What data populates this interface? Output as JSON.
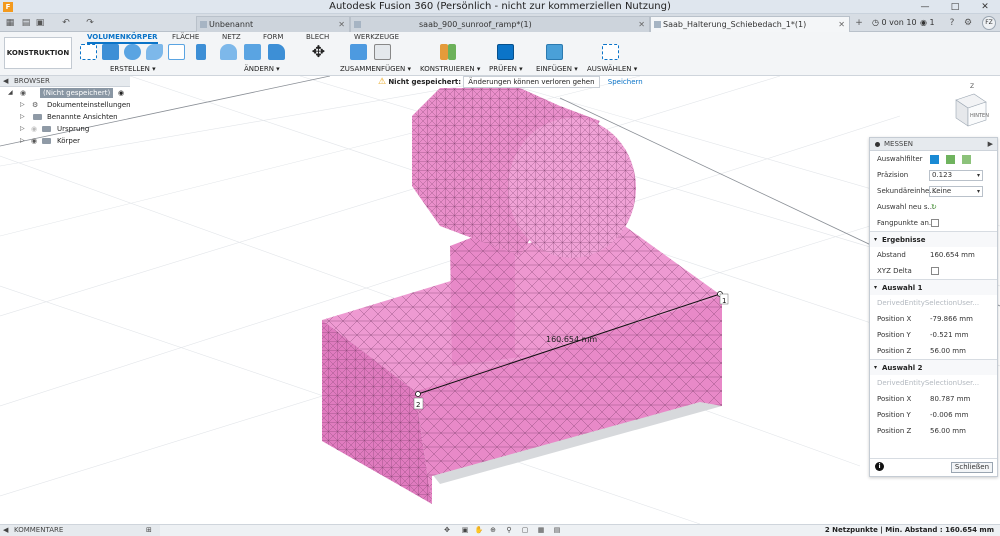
{
  "window": {
    "title": "Autodesk Fusion 360 (Persönlich - nicht zur kommerziellen Nutzung)",
    "app_icon": "F"
  },
  "tabs": [
    {
      "label": "Unbenannt",
      "active": false
    },
    {
      "label": "saab_900_sunroof_ramp*(1)",
      "active": false
    },
    {
      "label": "Saab_Halterung_Schiebedach_1*(1)",
      "active": true
    }
  ],
  "tabbar_right": {
    "jobs": "0 von 10",
    "notifications": "1",
    "avatar": "FZ"
  },
  "toolbar": {
    "workspace": "KONSTRUKTION",
    "ribbon_tabs": [
      "VOLUMENKÖRPER",
      "FLÄCHE",
      "NETZ",
      "FORM",
      "BLECH",
      "WERKZEUGE"
    ],
    "groups": [
      "ERSTELLEN",
      "ÄNDERN",
      "ZUSAMMENFÜGEN",
      "KONSTRUIEREN",
      "PRÜFEN",
      "EINFÜGEN",
      "AUSWÄHLEN"
    ]
  },
  "browser": {
    "header": "BROWSER",
    "root": "(Nicht gespeichert)",
    "items": [
      "Dokumenteinstellungen",
      "Benannte Ansichten",
      "Ursprung",
      "Körper"
    ]
  },
  "save_banner": {
    "label": "Nicht gespeichert:",
    "message": "Änderungen können verloren gehen",
    "link": "Speichern"
  },
  "viewport": {
    "dimension_label": "160.654 mm",
    "point1": "1",
    "point2": "2",
    "viewcube_face": "HINTEN",
    "viewcube_axis": "Z"
  },
  "measure": {
    "title": "MESSEN",
    "rows": {
      "filter_label": "Auswahlfilter",
      "precision_label": "Präzision",
      "precision_value": "0.123",
      "secondary_label": "Sekundäreinhe...",
      "secondary_value": "Keine",
      "reselect_label": "Auswahl neu s...",
      "snap_label": "Fangpunkte an..."
    },
    "results": {
      "header": "Ergebnisse",
      "distance_label": "Abstand",
      "distance_value": "160.654 mm",
      "xyz_label": "XYZ Delta"
    },
    "selection1": {
      "header": "Auswahl 1",
      "entity": "DerivedEntitySelectionUser...",
      "x_label": "Position X",
      "x_value": "-79.866 mm",
      "y_label": "Position Y",
      "y_value": "-0.521 mm",
      "z_label": "Position Z",
      "z_value": "56.00 mm"
    },
    "selection2": {
      "header": "Auswahl 2",
      "entity": "DerivedEntitySelectionUser...",
      "x_label": "Position X",
      "x_value": "80.787 mm",
      "y_label": "Position Y",
      "y_value": "-0.006 mm",
      "z_label": "Position Z",
      "z_value": "56.00 mm"
    },
    "close_button": "Schließen",
    "info": "i"
  },
  "statusbar": {
    "comments": "KOMMENTARE",
    "status": "2 Netzpunkte | Min. Abstand : 160.654 mm"
  },
  "colors": {
    "body_pink": "#e889c8",
    "accent_blue": "#0b74c8",
    "warning": "#e8a316"
  }
}
